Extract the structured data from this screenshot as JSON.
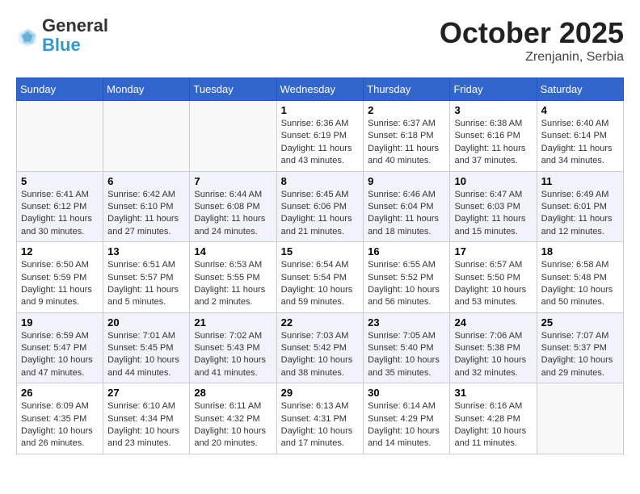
{
  "header": {
    "logo_general": "General",
    "logo_blue": "Blue",
    "month": "October 2025",
    "location": "Zrenjanin, Serbia"
  },
  "weekdays": [
    "Sunday",
    "Monday",
    "Tuesday",
    "Wednesday",
    "Thursday",
    "Friday",
    "Saturday"
  ],
  "weeks": [
    [
      {
        "day": "",
        "info": ""
      },
      {
        "day": "",
        "info": ""
      },
      {
        "day": "",
        "info": ""
      },
      {
        "day": "1",
        "info": "Sunrise: 6:36 AM\nSunset: 6:19 PM\nDaylight: 11 hours and 43 minutes."
      },
      {
        "day": "2",
        "info": "Sunrise: 6:37 AM\nSunset: 6:18 PM\nDaylight: 11 hours and 40 minutes."
      },
      {
        "day": "3",
        "info": "Sunrise: 6:38 AM\nSunset: 6:16 PM\nDaylight: 11 hours and 37 minutes."
      },
      {
        "day": "4",
        "info": "Sunrise: 6:40 AM\nSunset: 6:14 PM\nDaylight: 11 hours and 34 minutes."
      }
    ],
    [
      {
        "day": "5",
        "info": "Sunrise: 6:41 AM\nSunset: 6:12 PM\nDaylight: 11 hours and 30 minutes."
      },
      {
        "day": "6",
        "info": "Sunrise: 6:42 AM\nSunset: 6:10 PM\nDaylight: 11 hours and 27 minutes."
      },
      {
        "day": "7",
        "info": "Sunrise: 6:44 AM\nSunset: 6:08 PM\nDaylight: 11 hours and 24 minutes."
      },
      {
        "day": "8",
        "info": "Sunrise: 6:45 AM\nSunset: 6:06 PM\nDaylight: 11 hours and 21 minutes."
      },
      {
        "day": "9",
        "info": "Sunrise: 6:46 AM\nSunset: 6:04 PM\nDaylight: 11 hours and 18 minutes."
      },
      {
        "day": "10",
        "info": "Sunrise: 6:47 AM\nSunset: 6:03 PM\nDaylight: 11 hours and 15 minutes."
      },
      {
        "day": "11",
        "info": "Sunrise: 6:49 AM\nSunset: 6:01 PM\nDaylight: 11 hours and 12 minutes."
      }
    ],
    [
      {
        "day": "12",
        "info": "Sunrise: 6:50 AM\nSunset: 5:59 PM\nDaylight: 11 hours and 9 minutes."
      },
      {
        "day": "13",
        "info": "Sunrise: 6:51 AM\nSunset: 5:57 PM\nDaylight: 11 hours and 5 minutes."
      },
      {
        "day": "14",
        "info": "Sunrise: 6:53 AM\nSunset: 5:55 PM\nDaylight: 11 hours and 2 minutes."
      },
      {
        "day": "15",
        "info": "Sunrise: 6:54 AM\nSunset: 5:54 PM\nDaylight: 10 hours and 59 minutes."
      },
      {
        "day": "16",
        "info": "Sunrise: 6:55 AM\nSunset: 5:52 PM\nDaylight: 10 hours and 56 minutes."
      },
      {
        "day": "17",
        "info": "Sunrise: 6:57 AM\nSunset: 5:50 PM\nDaylight: 10 hours and 53 minutes."
      },
      {
        "day": "18",
        "info": "Sunrise: 6:58 AM\nSunset: 5:48 PM\nDaylight: 10 hours and 50 minutes."
      }
    ],
    [
      {
        "day": "19",
        "info": "Sunrise: 6:59 AM\nSunset: 5:47 PM\nDaylight: 10 hours and 47 minutes."
      },
      {
        "day": "20",
        "info": "Sunrise: 7:01 AM\nSunset: 5:45 PM\nDaylight: 10 hours and 44 minutes."
      },
      {
        "day": "21",
        "info": "Sunrise: 7:02 AM\nSunset: 5:43 PM\nDaylight: 10 hours and 41 minutes."
      },
      {
        "day": "22",
        "info": "Sunrise: 7:03 AM\nSunset: 5:42 PM\nDaylight: 10 hours and 38 minutes."
      },
      {
        "day": "23",
        "info": "Sunrise: 7:05 AM\nSunset: 5:40 PM\nDaylight: 10 hours and 35 minutes."
      },
      {
        "day": "24",
        "info": "Sunrise: 7:06 AM\nSunset: 5:38 PM\nDaylight: 10 hours and 32 minutes."
      },
      {
        "day": "25",
        "info": "Sunrise: 7:07 AM\nSunset: 5:37 PM\nDaylight: 10 hours and 29 minutes."
      }
    ],
    [
      {
        "day": "26",
        "info": "Sunrise: 6:09 AM\nSunset: 4:35 PM\nDaylight: 10 hours and 26 minutes."
      },
      {
        "day": "27",
        "info": "Sunrise: 6:10 AM\nSunset: 4:34 PM\nDaylight: 10 hours and 23 minutes."
      },
      {
        "day": "28",
        "info": "Sunrise: 6:11 AM\nSunset: 4:32 PM\nDaylight: 10 hours and 20 minutes."
      },
      {
        "day": "29",
        "info": "Sunrise: 6:13 AM\nSunset: 4:31 PM\nDaylight: 10 hours and 17 minutes."
      },
      {
        "day": "30",
        "info": "Sunrise: 6:14 AM\nSunset: 4:29 PM\nDaylight: 10 hours and 14 minutes."
      },
      {
        "day": "31",
        "info": "Sunrise: 6:16 AM\nSunset: 4:28 PM\nDaylight: 10 hours and 11 minutes."
      },
      {
        "day": "",
        "info": ""
      }
    ]
  ]
}
